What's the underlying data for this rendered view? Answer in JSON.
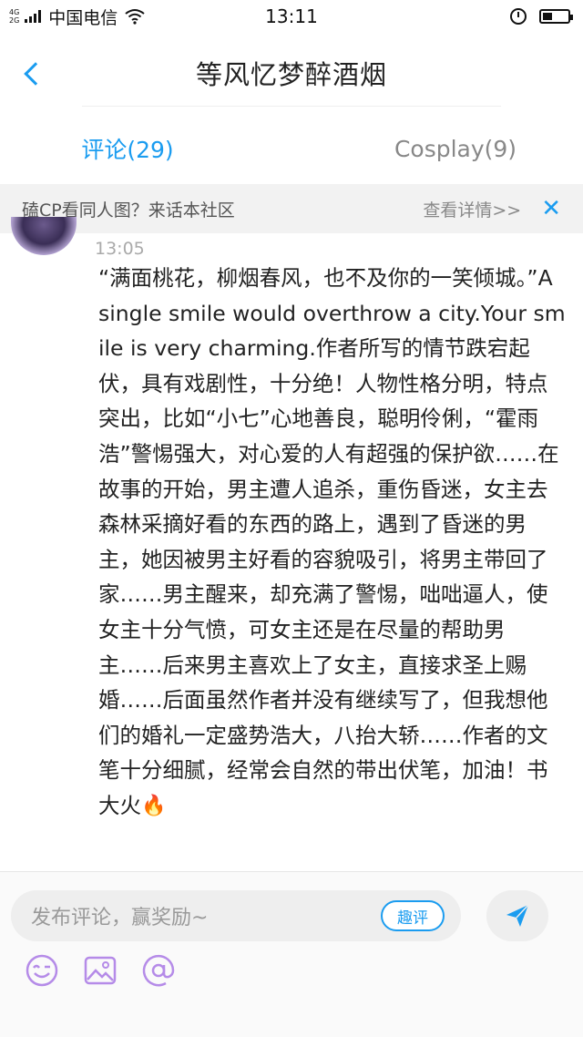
{
  "status_bar": {
    "net_top": "4G",
    "net_bottom": "2G",
    "carrier": "中国电信",
    "time": "13:11"
  },
  "header": {
    "title": "等风忆梦醉酒烟",
    "back_icon": "chevron-left-icon"
  },
  "tabs": [
    {
      "label": "评论(29)",
      "active": true
    },
    {
      "label": "Cosplay(9)",
      "active": false
    }
  ],
  "banner": {
    "text": "磕CP看同人图？来话本社区",
    "link": "查看详情>>",
    "close": "✕"
  },
  "comment": {
    "time": "13:05",
    "body": "“满面桃花，柳烟春风，也不及你的一笑倾城。”A single smile would overthrow a city.Your smile is very charming.作者所写的情节跌宕起伏，具有戏剧性，十分绝！人物性格分明，特点突出，比如“小七”心地善良，聪明伶俐，“霍雨浩”警惕强大，对心爱的人有超强的保护欲……在故事的开始，男主遭人追杀，重伤昏迷，女主去森林采摘好看的东西的路上，遇到了昏迷的男主，她因被男主好看的容貌吸引，将男主带回了家……男主醒来，却充满了警惕，咄咄逼人，使女主十分气愤，可女主还是在尽量的帮助男主……后来男主喜欢上了女主，直接求圣上赐婚……后面虽然作者并没有继续写了，但我想他们的婚礼一定盛势浩大，八抬大轿……作者的文笔十分细腻，经常会自然的带出伏笔，加油！书大火",
    "emoji": "🔥"
  },
  "input": {
    "placeholder": "发布评论，赢奖励~",
    "fun_button": "趣评"
  },
  "colors": {
    "accent": "#1a9cf0",
    "icon_purple": "#b58be8"
  },
  "icons": [
    "emoji-icon",
    "image-icon",
    "mention-icon",
    "send-icon"
  ]
}
